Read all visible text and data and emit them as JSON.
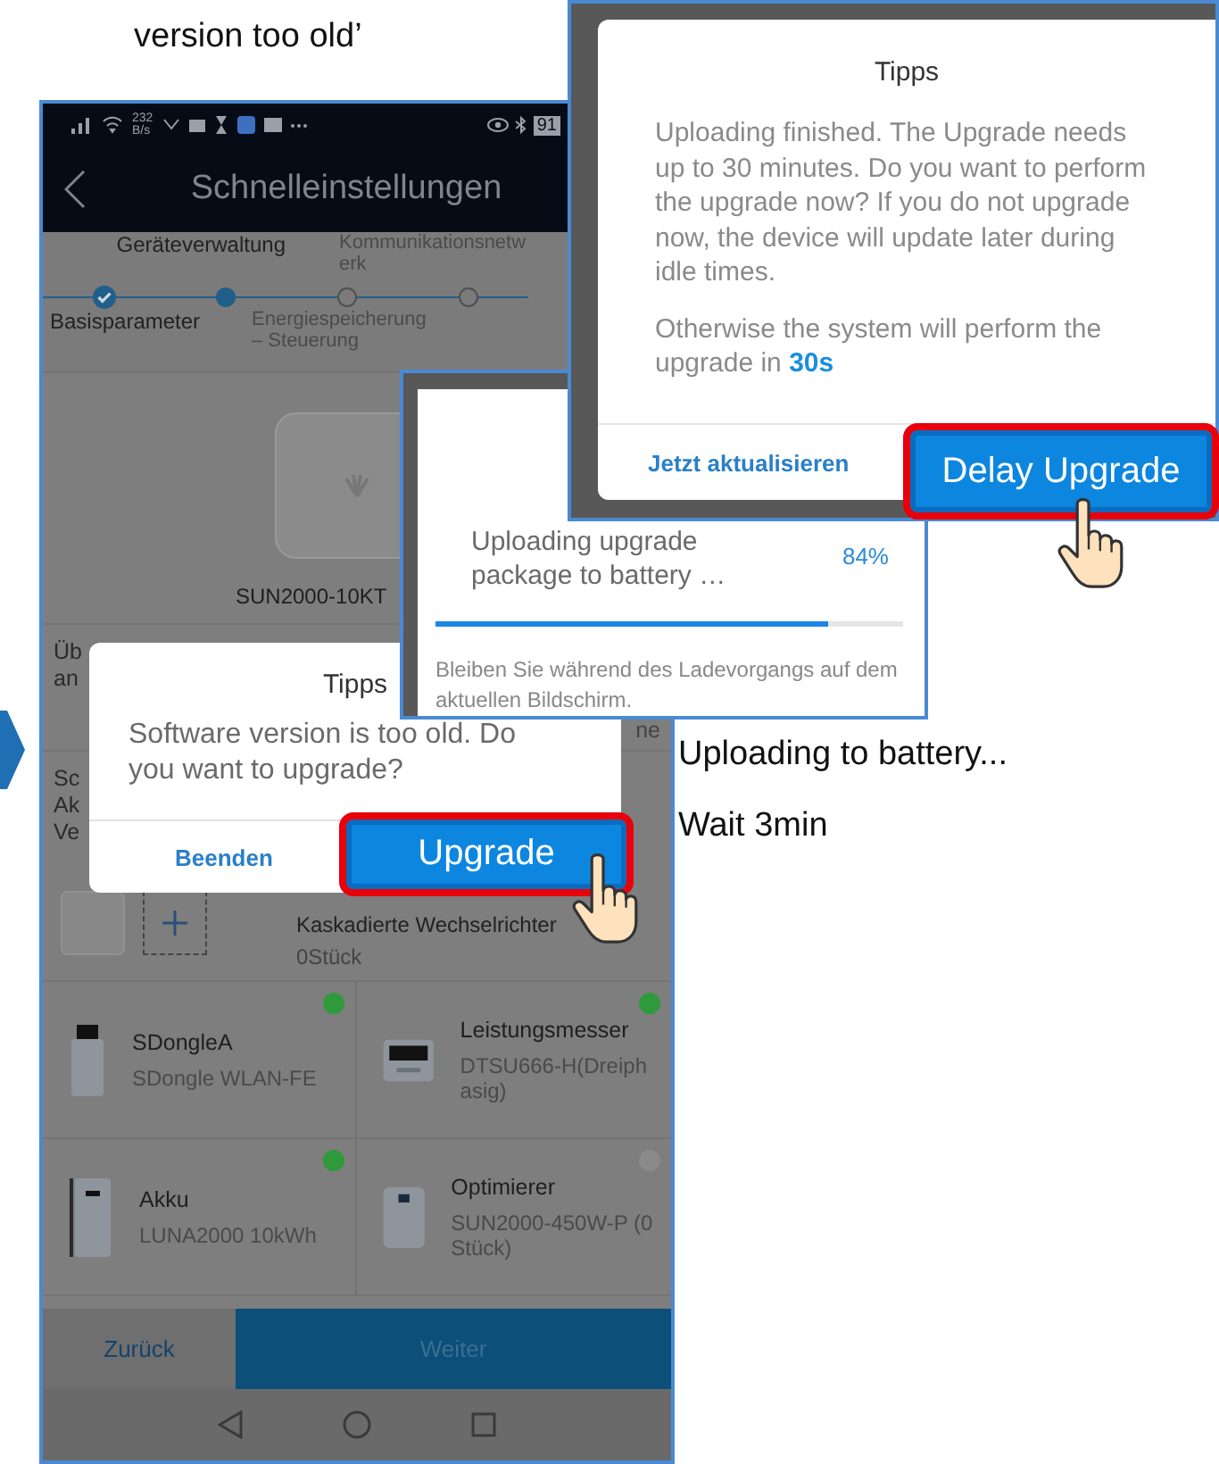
{
  "caption_top": "version too old’",
  "phone": {
    "status_bar": {
      "speed": "232",
      "speed_unit": "B/s",
      "battery": "91"
    },
    "header": {
      "title": "Schnelleinstellungen"
    },
    "steps": [
      {
        "label": "Basisparameter",
        "done": true,
        "current": false
      },
      {
        "label": "Geräteverwaltung",
        "done": false,
        "current": true
      },
      {
        "label": "Energiespeicherung – Steuerung",
        "done": false,
        "current": false
      },
      {
        "label": "Kommunikationsnetwerk",
        "done": false,
        "current": false
      }
    ],
    "device": {
      "name": "SUN2000-10KT"
    },
    "partial_rows": [
      {
        "lines": [
          "Üb",
          "an"
        ],
        "right": "ne"
      },
      {
        "lines": [
          "Sc",
          "Ak",
          "Ve"
        ]
      }
    ],
    "cascade": {
      "title": "Kaskadierte Wechselrichter",
      "count": "0Stück"
    },
    "devices": [
      {
        "kind": "dongle",
        "title": "SDongleA",
        "subtitle": "SDongle WLAN-FE",
        "color": "#2f9a3c"
      },
      {
        "kind": "meter",
        "title": "Leistungsmesser",
        "subtitle": "DTSU666-H(Dreiphasig)",
        "color": "#2f9a3c"
      },
      {
        "kind": "battery",
        "title": "Akku",
        "subtitle": "LUNA2000 10kWh",
        "color": "#2f9a3c"
      },
      {
        "kind": "optimizer",
        "title": "Optimierer",
        "subtitle": "SUN2000-450W-P (0Stück)",
        "color": "#8a8a8a"
      }
    ],
    "footer": {
      "back": "Zurück",
      "next": "Weiter"
    }
  },
  "dialog": {
    "title": "Tipps",
    "message": "Software version is too old. Do you want to upgrade?",
    "cancel": "Beenden",
    "confirm": "Upgrade"
  },
  "upload": {
    "message": "Uploading upgrade package to battery …",
    "percent": "84%",
    "level": 0.84,
    "note": "Bleiben Sie während des Ladevorgangs auf dem aktuellen Bildschirm."
  },
  "tips": {
    "title": "Tipps",
    "paragraphs": [
      "Uploading finished. The Upgrade needs up to 30 minutes. Do you want to perform the upgrade now? If you do not upgrade now, the device will update later during idle times.",
      "Otherwise the system will perform the upgrade in **30s**"
    ],
    "secondary": "Jetzt aktualisieren",
    "primary": "Delay Upgrade"
  },
  "captions": [
    "Uploading to battery...",
    "Wait 3min"
  ]
}
